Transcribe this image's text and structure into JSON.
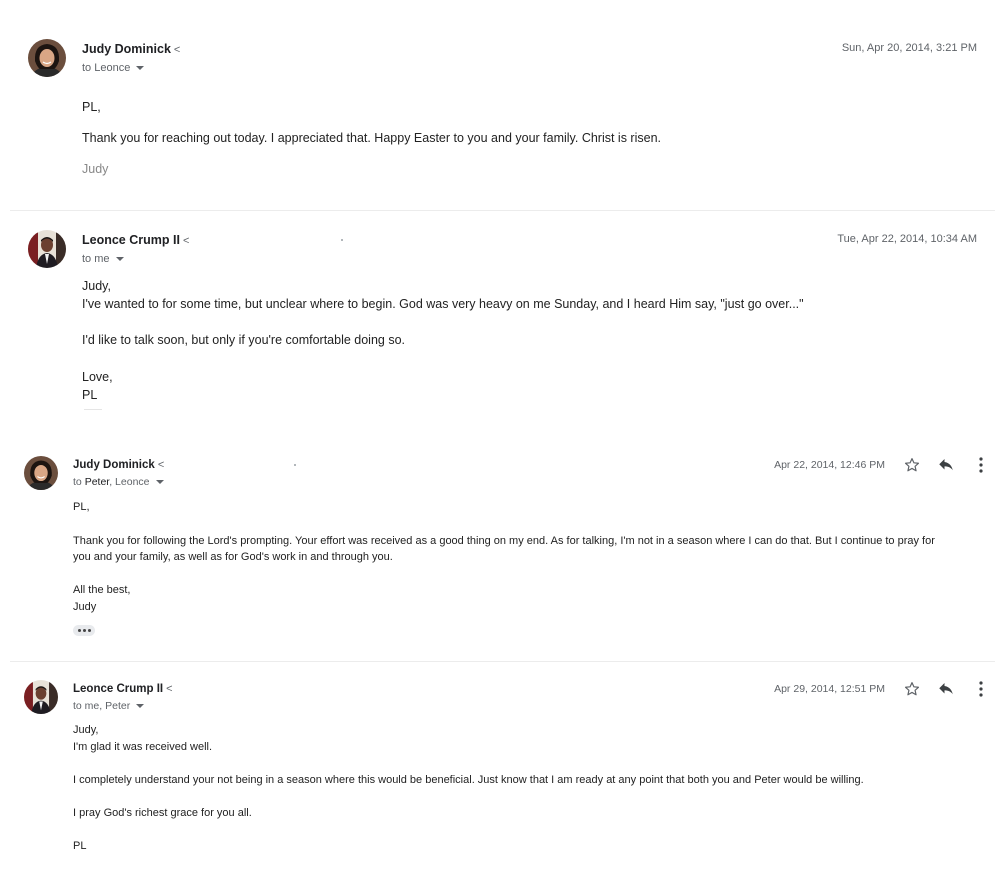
{
  "messages": [
    {
      "sender": "Judy Dominick",
      "recipients": "to Leonce",
      "date": "Sun, Apr 20, 2014, 3:21 PM",
      "body": [
        "PL,",
        "Thank you for reaching out today. I appreciated that. Happy Easter to you and your family. Christ is risen."
      ],
      "signature": "Judy"
    },
    {
      "sender": "Leonce Crump II",
      "recipients": "to me",
      "date": "Tue, Apr 22, 2014, 10:34 AM",
      "body": [
        "Judy,",
        "I've wanted to for some time, but unclear where to begin. God was very heavy on me Sunday, and I heard Him say, \"just go over...\"",
        "I'd like to talk soon, but only if you're comfortable doing so.",
        "Love,",
        "PL"
      ]
    },
    {
      "sender": "Judy Dominick",
      "recipients_bold": "Peter",
      "recipients_rest": ", Leonce",
      "recipients_prefix": "to ",
      "date": "Apr 22, 2014, 12:46 PM",
      "body": [
        "PL,",
        "Thank you for following the Lord's prompting.  Your effort was received as a good thing on my end.  As for talking, I'm not in a season where I can do that.  But I continue to pray for",
        "you and your family, as well as for God's work in and through you.",
        "All the best,",
        "Judy"
      ]
    },
    {
      "sender": "Leonce Crump II",
      "recipients": "to me, Peter",
      "date": "Apr 29, 2014, 12:51 PM",
      "body": [
        "Judy,",
        "I'm glad it was received well.",
        "I completely understand your not being in a season where this would be beneficial. Just know that I am ready at any point that both you and Peter would be willing.",
        "I pray God's richest grace for you all.",
        "PL"
      ]
    }
  ],
  "sender_caret": "<",
  "icons": [
    "star-icon",
    "reply-icon",
    "more-vert-icon",
    "ellipsis-icon"
  ]
}
